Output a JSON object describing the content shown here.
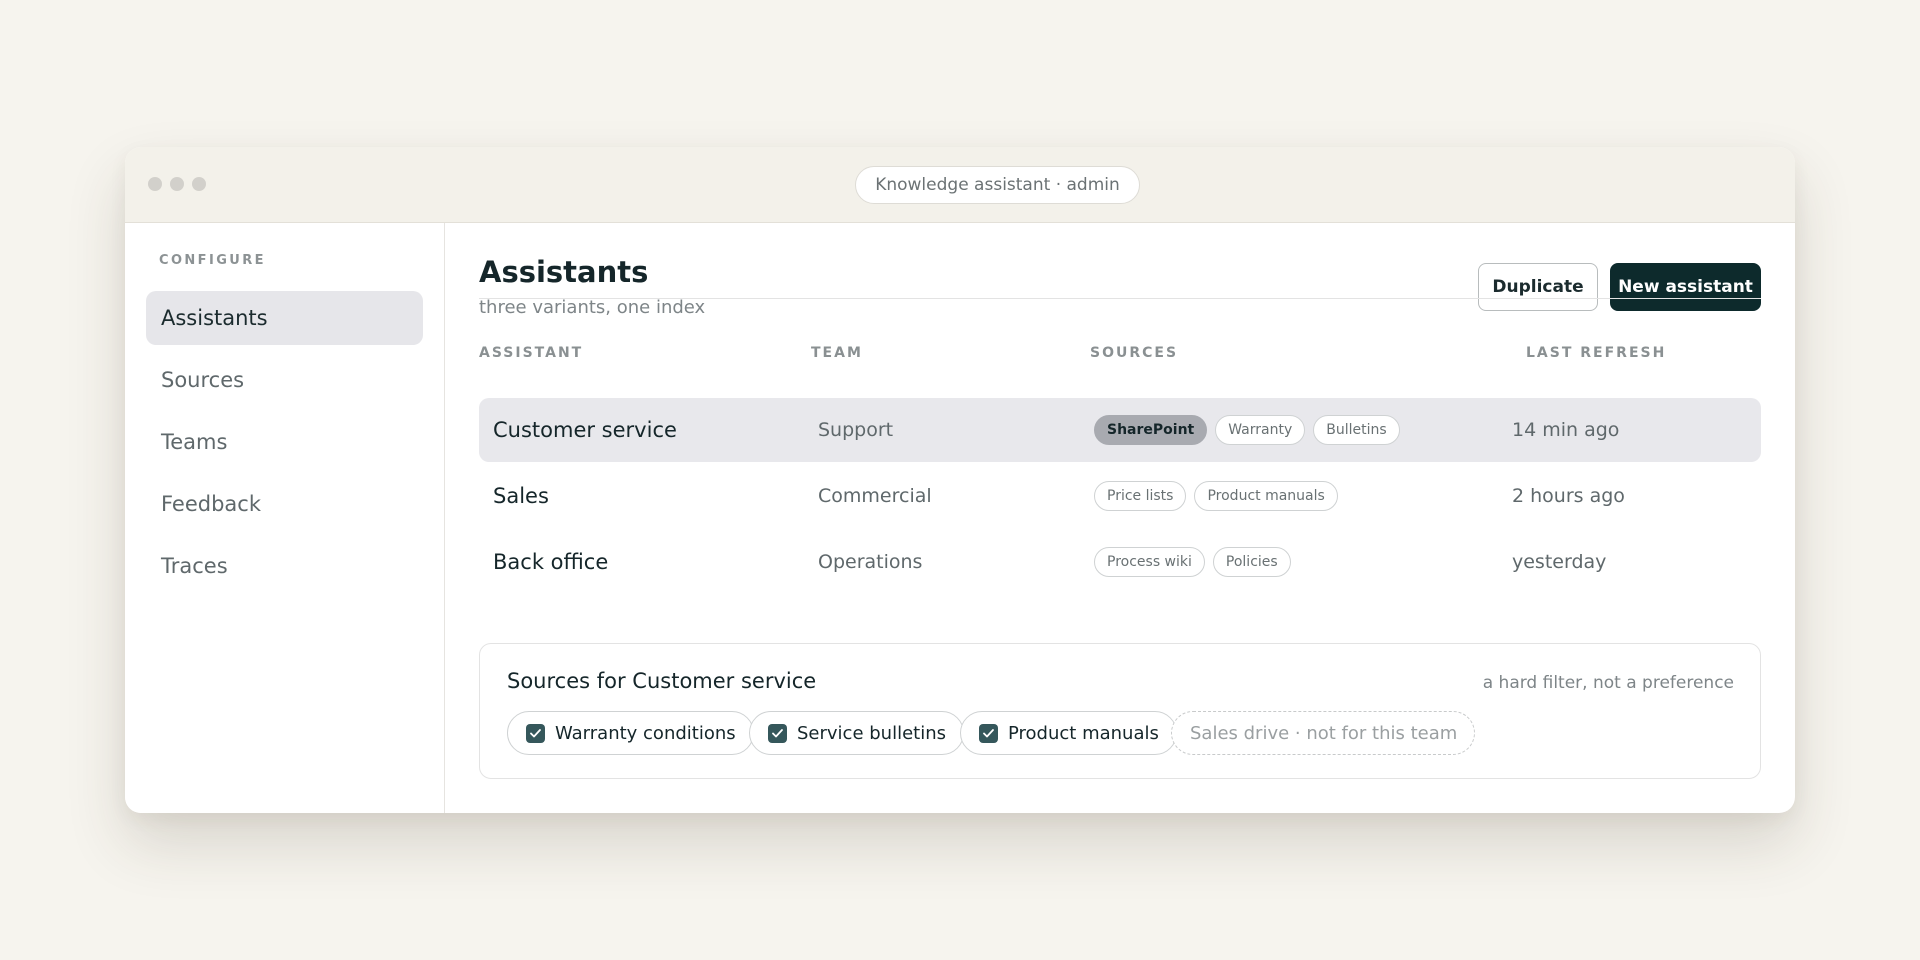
{
  "window": {
    "title": "Knowledge assistant · admin"
  },
  "sidebar": {
    "heading": "CONFIGURE",
    "items": [
      {
        "label": "Assistants",
        "active": true
      },
      {
        "label": "Sources",
        "active": false
      },
      {
        "label": "Teams",
        "active": false
      },
      {
        "label": "Feedback",
        "active": false
      },
      {
        "label": "Traces",
        "active": false
      }
    ]
  },
  "main": {
    "title": "Assistants",
    "subtitle": "three variants, one index",
    "buttons": {
      "duplicate": "Duplicate",
      "new_assistant": "New assistant"
    },
    "columns": {
      "assistant": "ASSISTANT",
      "team": "TEAM",
      "sources": "SOURCES",
      "last_refresh": "LAST REFRESH"
    },
    "rows": [
      {
        "name": "Customer service",
        "team": "Support",
        "sources": [
          "SharePoint",
          "Warranty",
          "Bulletins"
        ],
        "last_refresh": "14 min ago",
        "selected": true
      },
      {
        "name": "Sales",
        "team": "Commercial",
        "sources": [
          "Price lists",
          "Product manuals"
        ],
        "last_refresh": "2 hours ago",
        "selected": false
      },
      {
        "name": "Back office",
        "team": "Operations",
        "sources": [
          "Process wiki",
          "Policies"
        ],
        "last_refresh": "yesterday",
        "selected": false
      }
    ]
  },
  "panel": {
    "title": "Sources for Customer service",
    "note": "a hard filter, not a preference",
    "chips": [
      {
        "label": "Warranty conditions",
        "checked": true
      },
      {
        "label": "Service bulletins",
        "checked": true
      },
      {
        "label": "Product manuals",
        "checked": true
      },
      {
        "label": "Sales drive · not for this team",
        "checked": false
      }
    ]
  },
  "colors": {
    "page_background": "#f6f4ee",
    "primary_button": "#0d2a2c",
    "selected_row": "#e8e8ec",
    "checkbox": "#35575b"
  }
}
